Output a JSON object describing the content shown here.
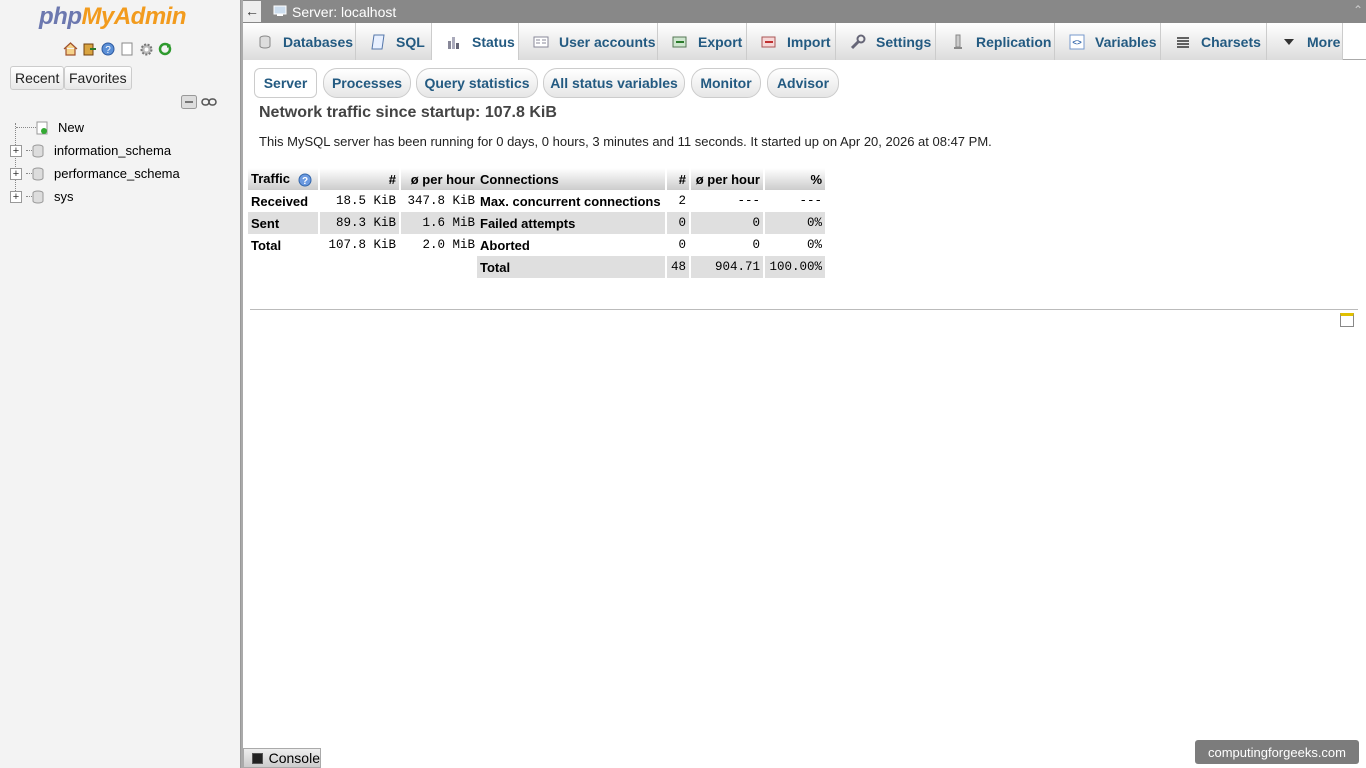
{
  "sidebar": {
    "logo_php": "php",
    "logo_myadmin": "MyAdmin",
    "recent_label": "Recent",
    "favorites_label": "Favorites",
    "tree": [
      {
        "label": "New",
        "expandable": false
      },
      {
        "label": "information_schema",
        "expandable": true
      },
      {
        "label": "performance_schema",
        "expandable": true
      },
      {
        "label": "sys",
        "expandable": true
      }
    ]
  },
  "topbar": {
    "title": "Server: localhost"
  },
  "tabs": [
    {
      "label": "Databases",
      "icon": "database-icon"
    },
    {
      "label": "SQL",
      "icon": "sql-icon"
    },
    {
      "label": "Status",
      "icon": "status-icon"
    },
    {
      "label": "User accounts",
      "icon": "users-icon"
    },
    {
      "label": "Export",
      "icon": "export-icon"
    },
    {
      "label": "Import",
      "icon": "import-icon"
    },
    {
      "label": "Settings",
      "icon": "wrench-icon"
    },
    {
      "label": "Replication",
      "icon": "replication-icon"
    },
    {
      "label": "Variables",
      "icon": "variables-icon"
    },
    {
      "label": "Charsets",
      "icon": "charsets-icon"
    },
    {
      "label": "More",
      "icon": "dropdown-arrow-icon"
    }
  ],
  "subtabs": [
    "Server",
    "Processes",
    "Query statistics",
    "All status variables",
    "Monitor",
    "Advisor"
  ],
  "main": {
    "heading": "Network traffic since startup: 107.8 KiB",
    "uptime": "This MySQL server has been running for 0 days, 0 hours, 3 minutes and 11 seconds. It started up on Apr 20, 2026 at 08:47 PM."
  },
  "traffic_table": {
    "headers": [
      "Traffic",
      "#",
      "ø per hour"
    ],
    "rows": [
      [
        "Received",
        "18.5 KiB",
        "347.8 KiB"
      ],
      [
        "Sent",
        "89.3 KiB",
        "1.6 MiB"
      ],
      [
        "Total",
        "107.8 KiB",
        "2.0 MiB"
      ]
    ]
  },
  "connections_table": {
    "headers": [
      "Connections",
      "#",
      "ø per hour",
      "%"
    ],
    "rows": [
      [
        "Max. concurrent connections",
        "2",
        "---",
        "---"
      ],
      [
        "Failed attempts",
        "0",
        "0",
        "0%"
      ],
      [
        "Aborted",
        "0",
        "0",
        "0%"
      ],
      [
        "Total",
        "48",
        "904.71",
        "100.00%"
      ]
    ]
  },
  "console": {
    "label": "Console"
  },
  "watermark": "computingforgeeks.com",
  "colors": {
    "link": "#235a81",
    "topbar": "#888888",
    "logo_php": "#6c78af",
    "logo_myadmin": "#f29b1d"
  }
}
